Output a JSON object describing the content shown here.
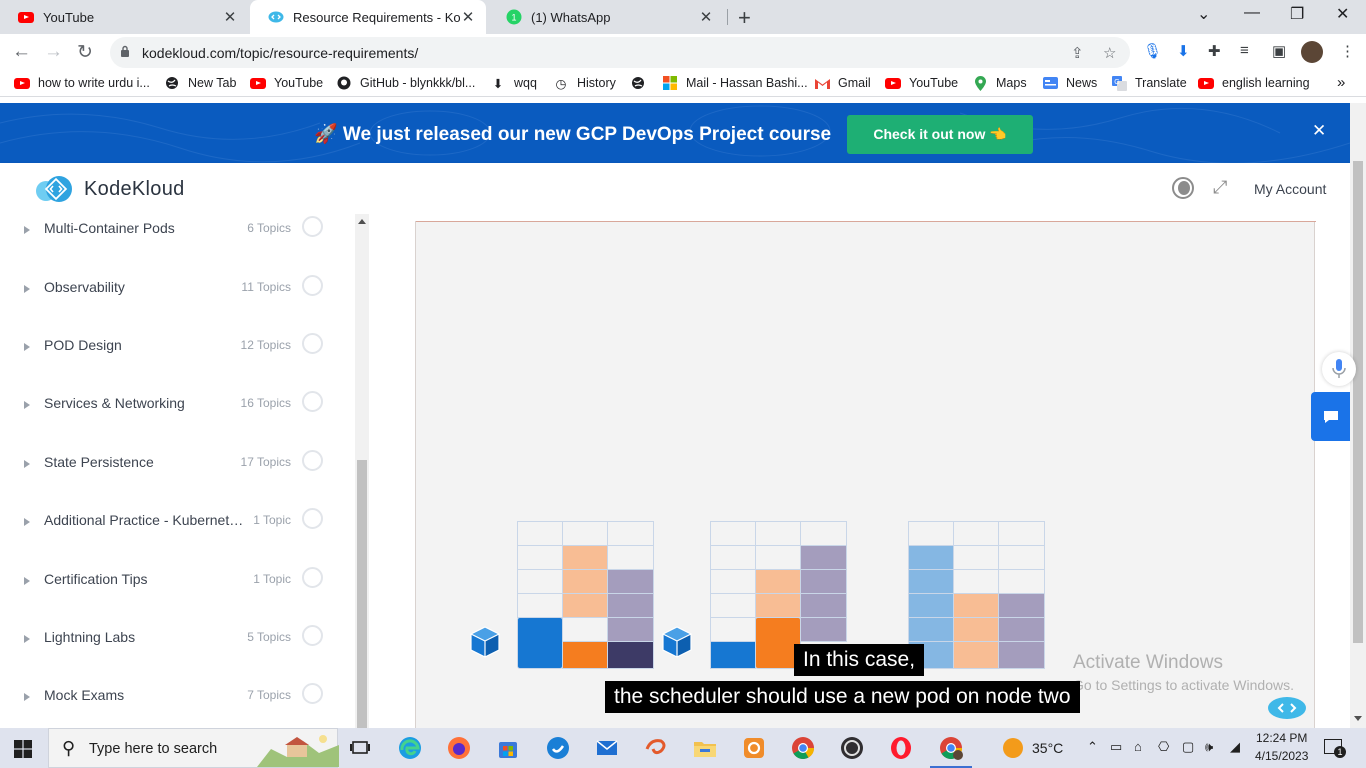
{
  "browser": {
    "tabs": [
      {
        "title": "YouTube",
        "icon": "youtube-icon"
      },
      {
        "title": "Resource Requirements - KodeKl",
        "icon": "kodekloud-icon"
      },
      {
        "title": "(1) WhatsApp",
        "icon": "whatsapp-icon"
      }
    ],
    "new_tab": "+",
    "url": "kodekloud.com/topic/resource-requirements/",
    "bookmarks": [
      {
        "label": "how to write urdu i...",
        "icon": "youtube-icon"
      },
      {
        "label": "New Tab",
        "icon": "globe-icon"
      },
      {
        "label": "YouTube",
        "icon": "youtube-icon"
      },
      {
        "label": "GitHub - blynkkk/bl...",
        "icon": "github-icon"
      },
      {
        "label": "wqq",
        "icon": "download-icon"
      },
      {
        "label": "History",
        "icon": "history-icon"
      },
      {
        "label": "",
        "icon": "globe-icon"
      },
      {
        "label": "Mail - Hassan Bashi...",
        "icon": "microsoft-icon"
      },
      {
        "label": "Gmail",
        "icon": "gmail-icon"
      },
      {
        "label": "YouTube",
        "icon": "youtube-icon"
      },
      {
        "label": "Maps",
        "icon": "maps-icon"
      },
      {
        "label": "News",
        "icon": "news-icon"
      },
      {
        "label": "Translate",
        "icon": "translate-icon"
      },
      {
        "label": "english learning",
        "icon": "youtube-icon"
      }
    ],
    "more_bookmarks": "»"
  },
  "banner": {
    "message": "🚀 We just released our new GCP DevOps Project course",
    "cta": "Check it out now 👈",
    "close": "✕",
    "color": "#0a5bbf",
    "cta_color": "#1eaf74"
  },
  "header": {
    "logo_text": "KodeKloud",
    "account": "My Account"
  },
  "sidebar": {
    "items": [
      {
        "name": "Multi-Container Pods",
        "count": "6 Topics"
      },
      {
        "name": "Observability",
        "count": "11 Topics"
      },
      {
        "name": "POD Design",
        "count": "12 Topics"
      },
      {
        "name": "Services & Networking",
        "count": "16 Topics"
      },
      {
        "name": "State Persistence",
        "count": "17 Topics"
      },
      {
        "name": "Additional Practice - Kubernetes for the Absolute Beginners",
        "count": "1 Topic"
      },
      {
        "name": "Certification Tips",
        "count": "1 Topic"
      },
      {
        "name": "Lightning Labs",
        "count": "5 Topics"
      },
      {
        "name": "Mock Exams",
        "count": "7 Topics"
      }
    ]
  },
  "video": {
    "captions": [
      "In this case,",
      "the scheduler should use a new pod on node two"
    ],
    "colors": {
      "blue": "#1677d2",
      "orange": "#f57d1f",
      "navy": "#3d3a66",
      "light_orange": "#f8bd94",
      "light_purple": "#a49dbd",
      "light_blue": "#85b7e3"
    }
  },
  "watermark": {
    "title": "Activate Windows",
    "subtitle": "Go to Settings to activate Windows."
  },
  "taskbar": {
    "search_placeholder": "Type here to search",
    "temperature": "35°C",
    "time": "12:24 PM",
    "date": "4/15/2023",
    "notification_count": "1"
  }
}
